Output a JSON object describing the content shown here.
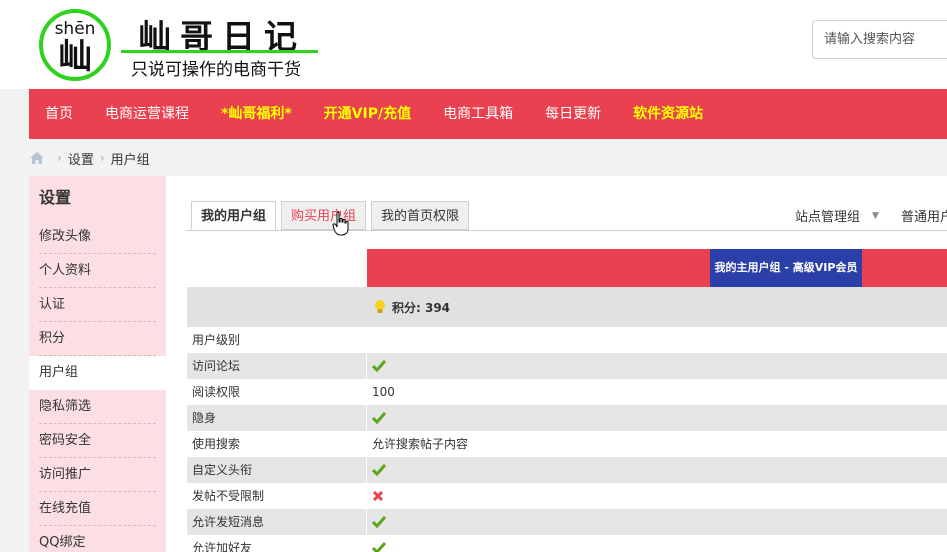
{
  "header": {
    "logo_pinyin": "shēn",
    "logo_char": "屾",
    "title": "屾哥日记",
    "slogan": "只说可操作的电商干货",
    "search_placeholder": "请输入搜索内容"
  },
  "nav": {
    "items": [
      {
        "label": "首页",
        "highlight": false
      },
      {
        "label": "电商运营课程",
        "highlight": false
      },
      {
        "label": "*屾哥福利*",
        "highlight": true
      },
      {
        "label": "开通VIP/充值",
        "highlight": true
      },
      {
        "label": "电商工具箱",
        "highlight": false
      },
      {
        "label": "每日更新",
        "highlight": false
      },
      {
        "label": "软件资源站",
        "highlight": true
      }
    ],
    "bg_color": "#e9414f",
    "highlight_color": "#ffff00"
  },
  "breadcrumb": {
    "icon": "home-icon",
    "items": [
      "设置",
      "用户组"
    ]
  },
  "sidebar": {
    "title": "设置",
    "items": [
      "修改头像",
      "个人资料",
      "认证",
      "积分",
      "用户组",
      "隐私筛选",
      "密码安全",
      "访问推广",
      "在线充值",
      "QQ绑定"
    ],
    "active": "用户组"
  },
  "tabs": {
    "items": [
      "我的用户组",
      "购买用户组",
      "我的首页权限"
    ],
    "active": "我的用户组",
    "hovered": "购买用户组"
  },
  "group_selectors": {
    "first": "站点管理组",
    "second": "普通用户"
  },
  "table": {
    "group_banner": "我的主用户组 - 高级VIP会员",
    "credits": "积分: 394",
    "rows": [
      {
        "label": "用户级别",
        "value": "",
        "mark": ""
      },
      {
        "label": "访问论坛",
        "value": "",
        "mark": "check"
      },
      {
        "label": "阅读权限",
        "value": "100",
        "mark": ""
      },
      {
        "label": "隐身",
        "value": "",
        "mark": "check"
      },
      {
        "label": "使用搜索",
        "value": "允许搜索帖子内容",
        "mark": ""
      },
      {
        "label": "自定义头衔",
        "value": "",
        "mark": "check"
      },
      {
        "label": "发帖不受限制",
        "value": "",
        "mark": "cross"
      },
      {
        "label": "允许发短消息",
        "value": "",
        "mark": "check"
      },
      {
        "label": "允许加好友",
        "value": "",
        "mark": "check"
      }
    ]
  },
  "colors": {
    "accent": "#e9414f",
    "banner": "#2b3fa8",
    "logo_green": "#2fd31f",
    "sidebar_bg": "#fcdfe2"
  }
}
